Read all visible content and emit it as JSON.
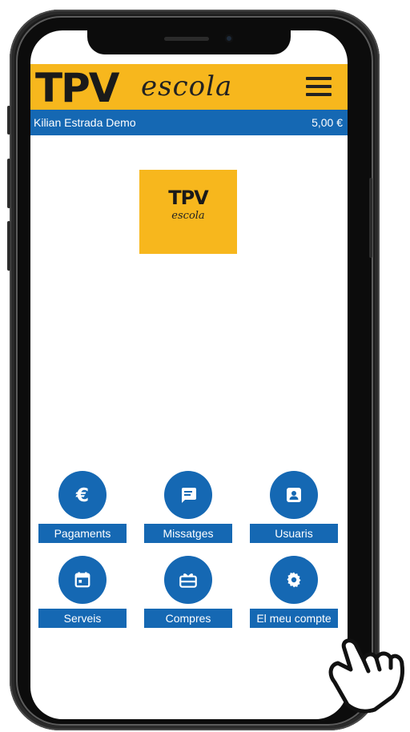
{
  "app": {
    "brand_main": "TPV",
    "brand_sub": "escola"
  },
  "user_bar": {
    "name": "Kilian Estrada Demo",
    "balance": "5,00 €"
  },
  "logo": {
    "main": "TPV",
    "sub": "escola"
  },
  "menu": [
    {
      "label": "Pagaments",
      "icon": "euro-icon"
    },
    {
      "label": "Missatges",
      "icon": "message-icon"
    },
    {
      "label": "Usuaris",
      "icon": "contact-icon"
    },
    {
      "label": "Serveis",
      "icon": "calendar-icon"
    },
    {
      "label": "Compres",
      "icon": "gift-card-icon"
    },
    {
      "label": "El meu compte",
      "icon": "gear-icon"
    }
  ],
  "colors": {
    "accent_yellow": "#f7b71d",
    "primary_blue": "#1568b3",
    "frame": "#0c0c0c"
  }
}
